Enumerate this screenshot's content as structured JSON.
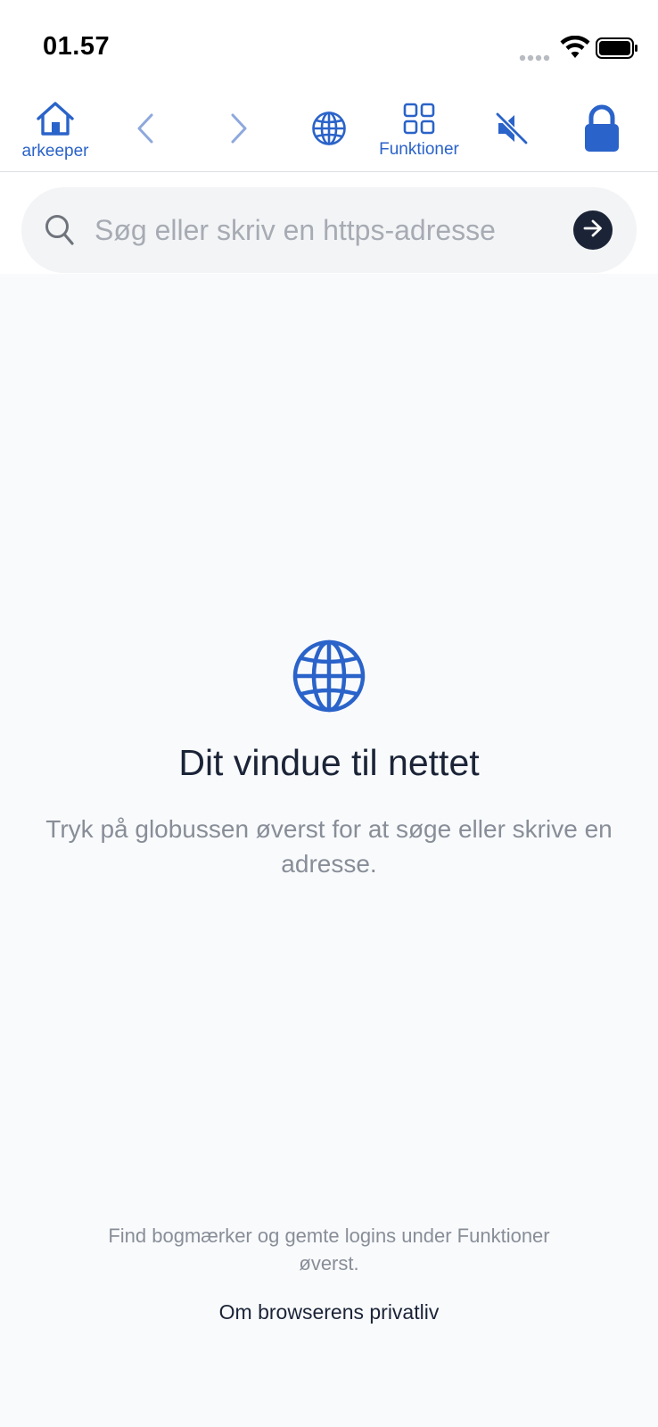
{
  "status_bar": {
    "time": "01.57",
    "icons": [
      "signal-dots-icon",
      "wifi-icon",
      "battery-icon"
    ]
  },
  "toolbar": {
    "home_label": "arkeeper",
    "functions_label": "Funktioner",
    "icons": [
      "home-icon",
      "back-icon",
      "forward-icon",
      "globe-icon",
      "grid-icon",
      "mute-icon",
      "lock-icon"
    ],
    "accent_color": "#2a63c9",
    "disabled_color": "#8ea8dc"
  },
  "search": {
    "placeholder": "Søg eller skriv en https-adresse",
    "value": "",
    "go_icon": "arrow-right-icon"
  },
  "empty_state": {
    "icon": "globe-icon",
    "title": "Dit vindue til nettet",
    "description": "Tryk på globussen øverst for at søge eller skrive en adresse."
  },
  "footer": {
    "hint": "Find bogmærker og gemte logins under Funktioner øverst.",
    "privacy_link": "Om browserens privatliv"
  }
}
